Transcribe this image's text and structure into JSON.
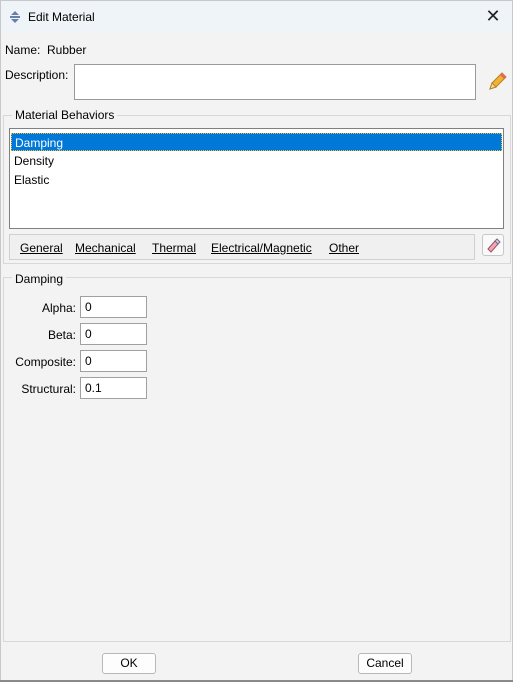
{
  "window": {
    "title": "Edit Material",
    "close_glyph": "✕"
  },
  "name": {
    "label": "Name:",
    "value": "Rubber"
  },
  "description": {
    "label": "Description:",
    "value": ""
  },
  "behaviors": {
    "legend": "Material Behaviors",
    "items": [
      "Damping",
      "Density",
      "Elastic"
    ],
    "selected": "Damping"
  },
  "menus": [
    "General",
    "Mechanical",
    "Thermal",
    "Electrical/Magnetic",
    "Other"
  ],
  "damping": {
    "legend": "Damping",
    "fields": [
      {
        "label": "Alpha:",
        "value": "0"
      },
      {
        "label": "Beta:",
        "value": "0"
      },
      {
        "label": "Composite:",
        "value": "0"
      },
      {
        "label": "Structural:",
        "value": "0.1"
      }
    ]
  },
  "buttons": {
    "ok": "OK",
    "cancel": "Cancel"
  },
  "icons": {
    "app": "material-app-icon",
    "edit": "pencil-icon",
    "erase": "eraser-icon"
  },
  "colors": {
    "selection": "#0078d7",
    "titlebar": "#eef4f8"
  }
}
